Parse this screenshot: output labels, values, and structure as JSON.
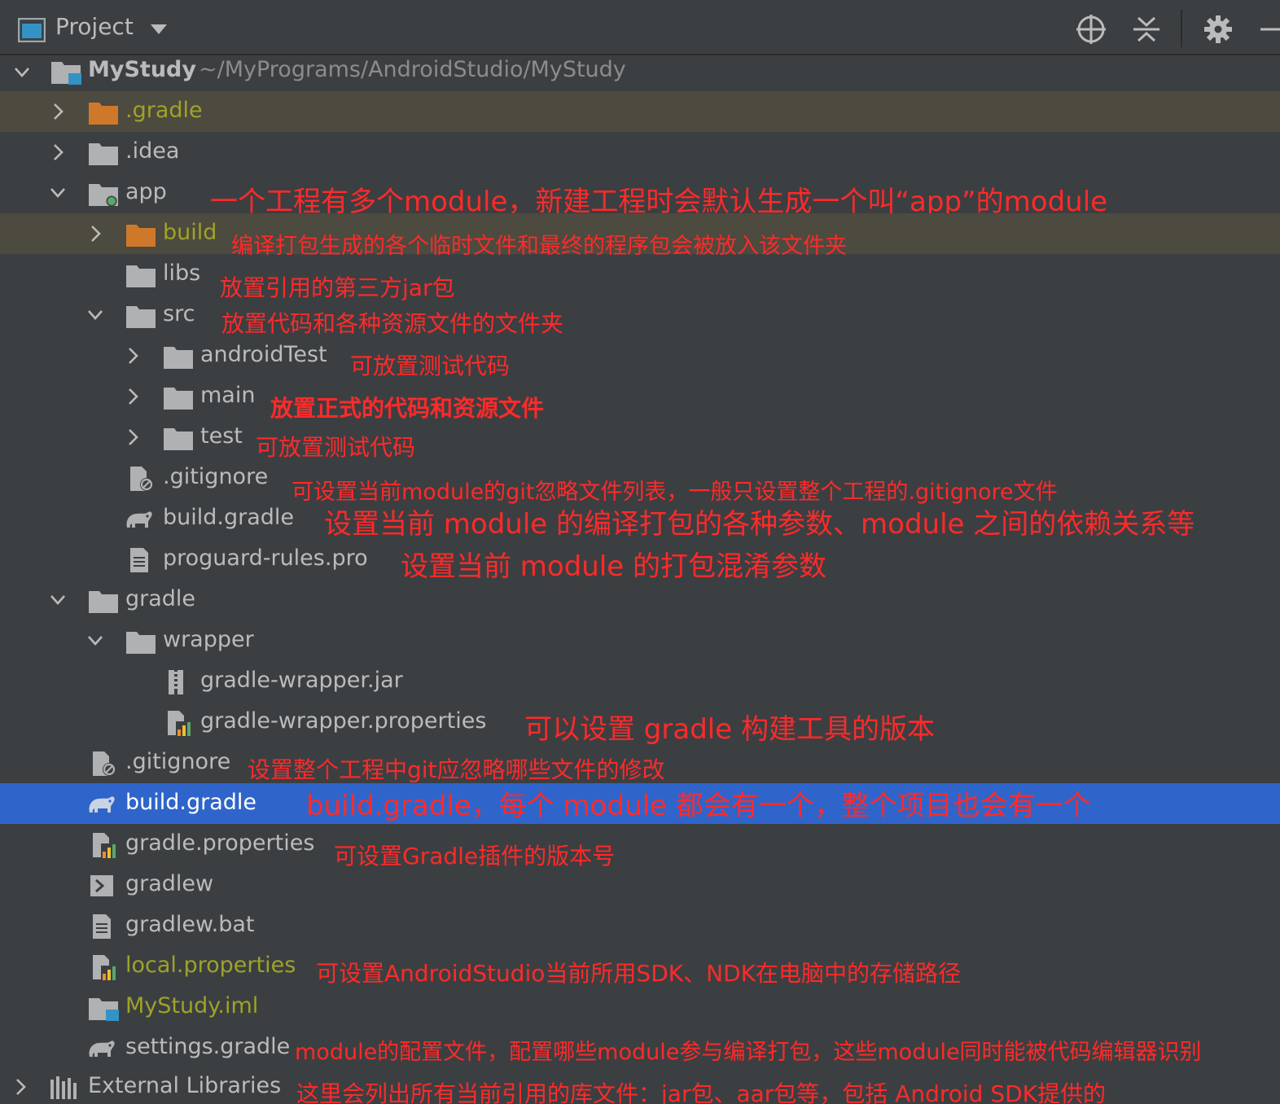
{
  "header": {
    "title": "Project",
    "icons": [
      "project-view-icon",
      "dropdown-icon",
      "locate-icon",
      "collapse-all-icon",
      "gear-icon",
      "hide-icon"
    ]
  },
  "tree": {
    "root": {
      "name": "MyStudy",
      "path": "~/MyPrograms/AndroidStudio/MyStudy"
    },
    "rows": [
      {
        "name": ".gradle"
      },
      {
        "name": ".idea"
      },
      {
        "name": "app",
        "note": "一个工程有多个module，新建工程时会默认生成一个叫“app”的module"
      },
      {
        "name": "build",
        "note": "编译打包生成的各个临时文件和最终的程序包会被放入该文件夹"
      },
      {
        "name": "libs",
        "note": "放置引用的第三方jar包"
      },
      {
        "name": "src",
        "note": "放置代码和各种资源文件的文件夹"
      },
      {
        "name": "androidTest",
        "note": "可放置测试代码"
      },
      {
        "name": "main",
        "note": "放置正式的代码和资源文件"
      },
      {
        "name": "test",
        "note": "可放置测试代码"
      },
      {
        "name": ".gitignore",
        "note": "可设置当前module的git忽略文件列表，一般只设置整个工程的.gitignore文件"
      },
      {
        "name": "build.gradle",
        "note": "设置当前 module 的编译打包的各种参数、module 之间的依赖关系等"
      },
      {
        "name": "proguard-rules.pro",
        "note": "设置当前 module 的打包混淆参数"
      },
      {
        "name": "gradle"
      },
      {
        "name": "wrapper"
      },
      {
        "name": "gradle-wrapper.jar"
      },
      {
        "name": "gradle-wrapper.properties",
        "note": "可以设置 gradle 构建工具的版本"
      },
      {
        "name": ".gitignore",
        "note": "设置整个工程中git应忽略哪些文件的修改"
      },
      {
        "name": "build.gradle",
        "note": "build.gradle，每个 module 都会有一个，整个项目也会有一个"
      },
      {
        "name": "gradle.properties",
        "note": "可设置Gradle插件的版本号"
      },
      {
        "name": "gradlew"
      },
      {
        "name": "gradlew.bat"
      },
      {
        "name": "local.properties",
        "note": "可设置AndroidStudio当前所用SDK、NDK在电脑中的存储路径"
      },
      {
        "name": "MyStudy.iml"
      },
      {
        "name": "settings.gradle",
        "note": "module的配置文件，配置哪些module参与编译打包，这些module同时能被代码编辑器识别"
      },
      {
        "name": "External Libraries",
        "note": "这里会列出所有当前引用的库文件：jar包、aar包等，包括 Android SDK提供的"
      }
    ]
  },
  "colors": {
    "panel_bg": "#3c3f41",
    "selected_row": "#2f65ca",
    "excluded_row": "#4d4a3f",
    "annotation": "#ff2a2a",
    "folder": "#afb1b3",
    "excluded_folder": "#d0782a"
  }
}
